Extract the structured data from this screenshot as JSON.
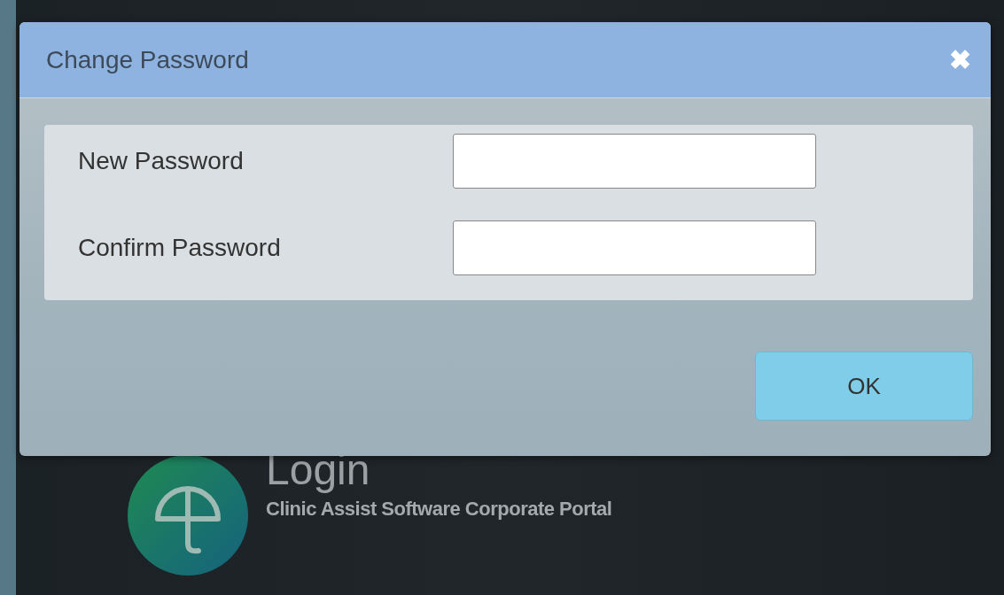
{
  "dialog": {
    "title": "Change Password",
    "close": "✖",
    "fields": [
      {
        "label": "New Password"
      },
      {
        "label": "Confirm Password"
      }
    ],
    "buttons": [
      "OK"
    ]
  },
  "login": {
    "title": "Login",
    "subtitle": "Clinic Assist Software Corporate Portal"
  }
}
